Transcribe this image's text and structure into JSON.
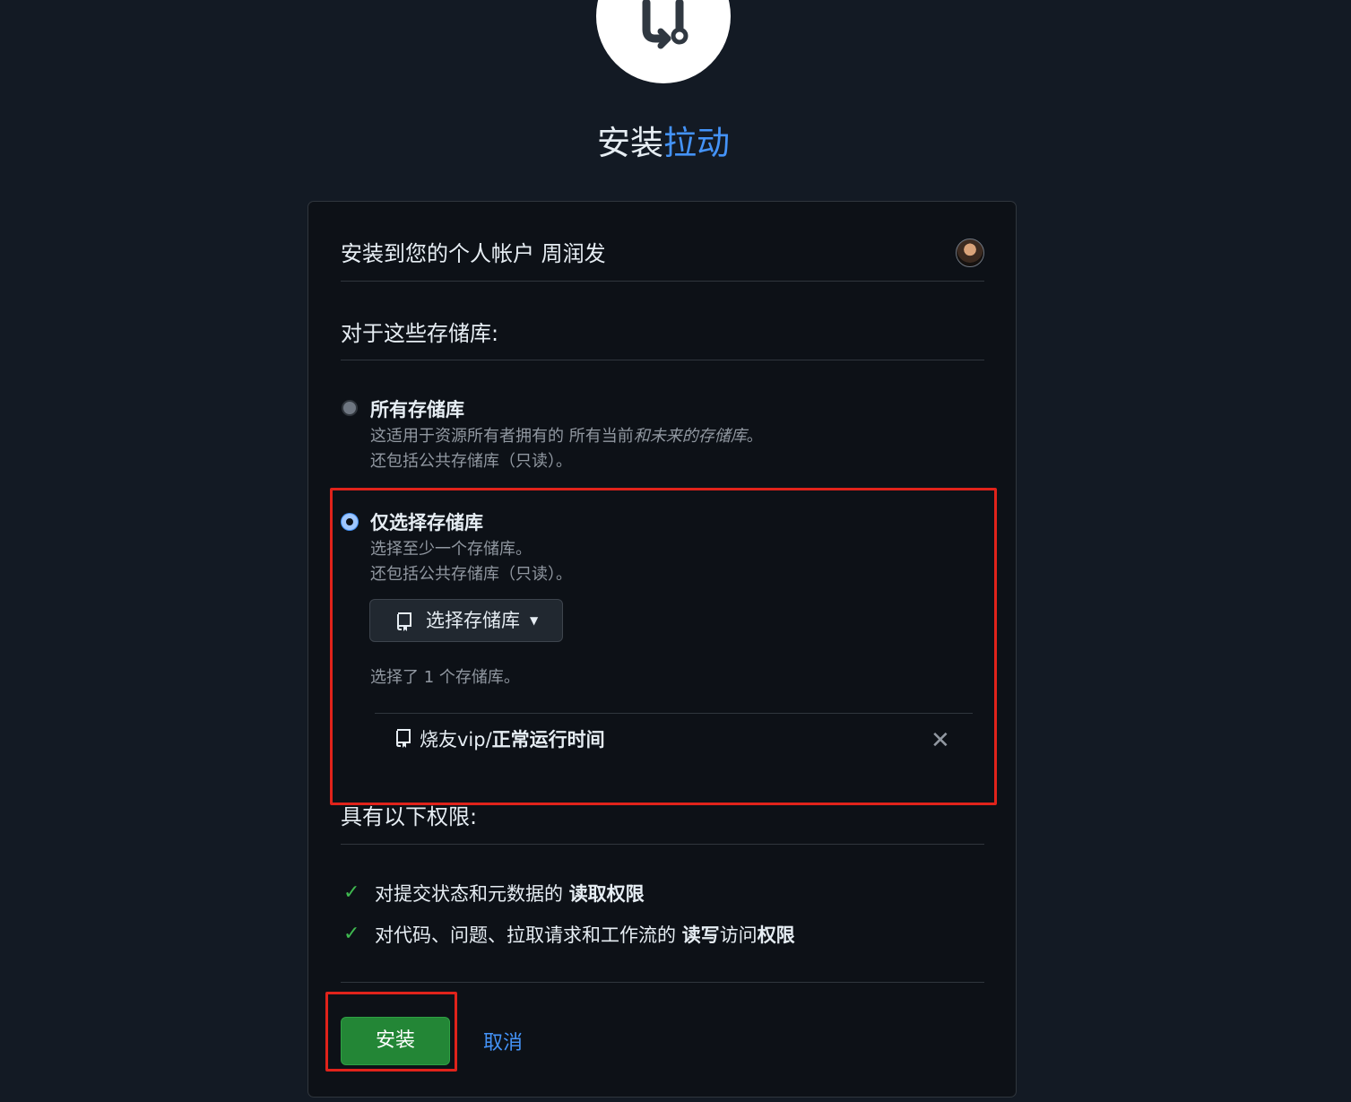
{
  "app": {
    "title_plain": "安装",
    "title_link": "拉动"
  },
  "account": {
    "text": "安装到您的个人帐户 周润发"
  },
  "repositories": {
    "heading": "对于这些存储库:",
    "all": {
      "label": "所有存储库",
      "desc_line1_prefix": "这适用于资源所有者拥有的 所有当前",
      "desc_line1_italic": "和未来的存储库",
      "desc_line1_suffix": "。",
      "desc_line2": "还包括公共存储库（只读）。"
    },
    "selected": {
      "label": "仅选择存储库",
      "desc_line1": "选择至少一个存储库。",
      "desc_line2": "还包括公共存储库（只读）。",
      "select_button": "选择存储库",
      "count_text": "选择了 1 个存储库。",
      "repo_owner": "烧友vip/",
      "repo_name": "正常运行时间"
    }
  },
  "permissions": {
    "heading": "具有以下权限:",
    "items": [
      {
        "prefix": "对提交状态和元数据的 ",
        "bold": "读取权限"
      },
      {
        "prefix": "对代码、问题、拉取请求和工作流的 ",
        "bold1": "读写",
        "middle": "访问",
        "bold2": "权限"
      }
    ]
  },
  "actions": {
    "install": "安装",
    "cancel": "取消"
  },
  "colors": {
    "background": "#131a24",
    "card": "#0d1117",
    "accent_link": "#4493f8",
    "install_green": "#238636",
    "check_green": "#3fb950",
    "highlight_red": "#e0231b"
  },
  "icons": [
    "app-logo-icon",
    "repo-icon",
    "caret-down-icon",
    "close-icon",
    "check-icon"
  ]
}
